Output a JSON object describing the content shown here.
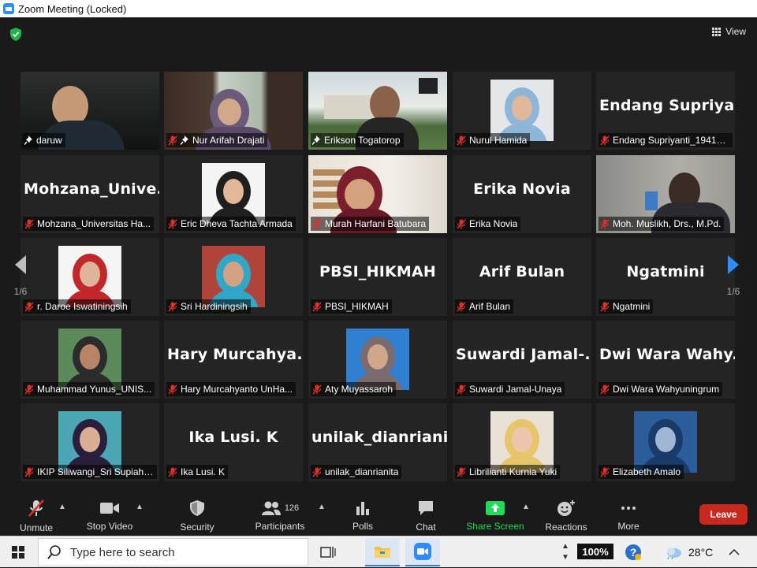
{
  "window": {
    "title": "Zoom Meeting (Locked)"
  },
  "view": {
    "label": "View"
  },
  "pages": {
    "left": "1/6",
    "right": "1/6"
  },
  "tiles": [
    {
      "name": "daruw",
      "muted": false,
      "pinned": true,
      "type": "video",
      "active": true
    },
    {
      "name": "Nur Arifah Drajati",
      "muted": true,
      "pinned": true,
      "type": "video"
    },
    {
      "name": "Erikson Togatorop",
      "muted": false,
      "pinned": true,
      "type": "video"
    },
    {
      "name": "Nurul Hamida",
      "muted": true,
      "pinned": false,
      "type": "photo"
    },
    {
      "name": "Endang Supriyanti_19410...",
      "muted": true,
      "pinned": false,
      "type": "text",
      "big": "Endang  Supriya..."
    },
    {
      "name": "Mohzana_Universitas Ha...",
      "muted": true,
      "pinned": false,
      "type": "text",
      "big": "Mohzana_Unive..."
    },
    {
      "name": "Eric Dheva Tachta Armada",
      "muted": true,
      "pinned": false,
      "type": "photo"
    },
    {
      "name": "Murah Harfani Batubara",
      "muted": true,
      "pinned": false,
      "type": "video"
    },
    {
      "name": "Erika Novia",
      "muted": true,
      "pinned": false,
      "type": "text",
      "big": "Erika Novia"
    },
    {
      "name": "Moh. Muslikh, Drs., M.Pd.",
      "muted": true,
      "pinned": false,
      "type": "video"
    },
    {
      "name": "r. Daroe Iswatiningsih",
      "muted": true,
      "pinned": false,
      "type": "photo"
    },
    {
      "name": "Sri Hardiningsih",
      "muted": true,
      "pinned": false,
      "type": "photo"
    },
    {
      "name": "PBSI_HIKMAH",
      "muted": true,
      "pinned": false,
      "type": "text",
      "big": "PBSI_HIKMAH"
    },
    {
      "name": "Arif Bulan",
      "muted": true,
      "pinned": false,
      "type": "text",
      "big": "Arif Bulan"
    },
    {
      "name": "Ngatmini",
      "muted": true,
      "pinned": false,
      "type": "text",
      "big": "Ngatmini"
    },
    {
      "name": "Muhammad Yunus_UNIS...",
      "muted": true,
      "pinned": false,
      "type": "photo"
    },
    {
      "name": "Hary Murcahyanto UnHa...",
      "muted": true,
      "pinned": false,
      "type": "text",
      "big": "Hary  Murcahya..."
    },
    {
      "name": "Aty Muyassaroh",
      "muted": true,
      "pinned": false,
      "type": "photo"
    },
    {
      "name": "Suwardi Jamal-Unaya",
      "muted": true,
      "pinned": false,
      "type": "text",
      "big": "Suwardi  Jamal-..."
    },
    {
      "name": "Dwi Wara Wahyuningrum",
      "muted": true,
      "pinned": false,
      "type": "text",
      "big": "Dwi  Wara  Wahy..."
    },
    {
      "name": "IKIP Siliwangi_Sri Supiah ...",
      "muted": true,
      "pinned": false,
      "type": "photo"
    },
    {
      "name": "Ika Lusi. K",
      "muted": true,
      "pinned": false,
      "type": "text",
      "big": "Ika Lusi. K"
    },
    {
      "name": "unilak_dianrianita",
      "muted": true,
      "pinned": false,
      "type": "text",
      "big": "unilak_dianrianita"
    },
    {
      "name": "Librilianti Kurnia Yuki",
      "muted": true,
      "pinned": false,
      "type": "photo"
    },
    {
      "name": "Elizabeth Amalo",
      "muted": true,
      "pinned": false,
      "type": "photo"
    }
  ],
  "toolbar": {
    "unmute": "Unmute",
    "stop_video": "Stop Video",
    "security": "Security",
    "participants": "Participants",
    "participants_count": "126",
    "polls": "Polls",
    "chat": "Chat",
    "share_screen": "Share Screen",
    "reactions": "Reactions",
    "more": "More",
    "leave": "Leave"
  },
  "taskbar": {
    "search_placeholder": "Type here to search",
    "zoom_level": "100%",
    "temperature": "28°C"
  }
}
